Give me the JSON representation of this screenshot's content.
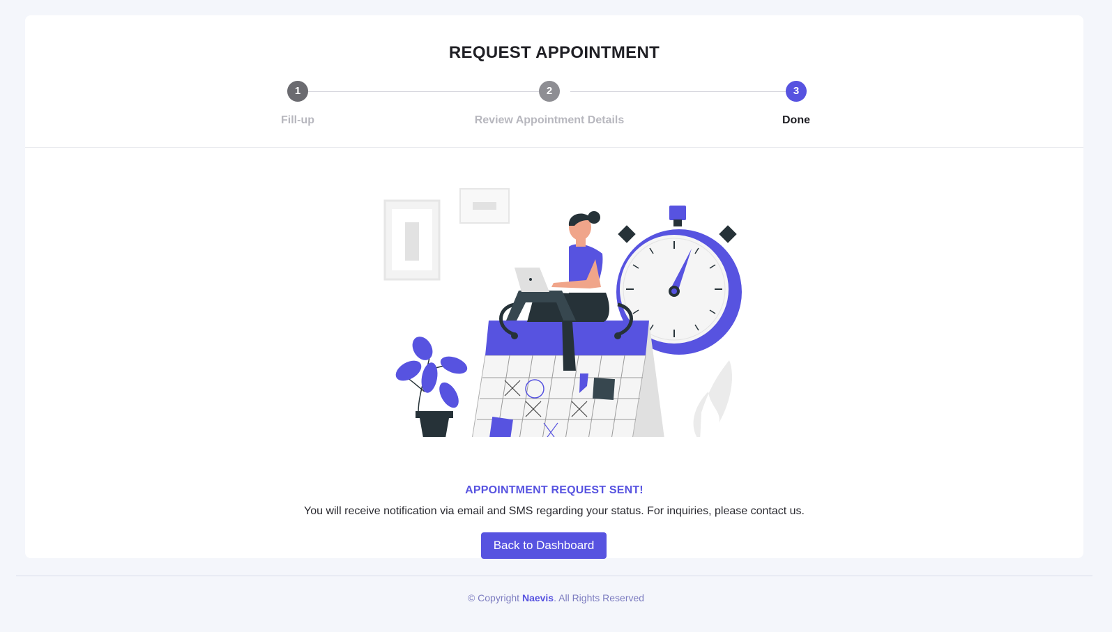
{
  "header": {
    "title": "REQUEST APPOINTMENT"
  },
  "stepper": {
    "steps": [
      {
        "number": "1",
        "label": "Fill-up",
        "color": "#6b6b70"
      },
      {
        "number": "2",
        "label": "Review Appointment Details",
        "color": "#8e8e93"
      },
      {
        "number": "3",
        "label": "Done",
        "color": "#5753e0"
      }
    ],
    "active_step": 3
  },
  "confirmation": {
    "title": "APPOINTMENT REQUEST SENT!",
    "message": "You will receive notification via email and SMS regarding your status. For inquiries, please contact us.",
    "button_label": "Back to Dashboard"
  },
  "illustration": {
    "icon": "appointment-illustration"
  },
  "footer": {
    "prefix": "© Copyright ",
    "brand": "Naevis",
    "suffix": ". All Rights Reserved"
  },
  "colors": {
    "accent": "#5753e0",
    "dark": "#263238",
    "background": "#f4f6fb"
  }
}
